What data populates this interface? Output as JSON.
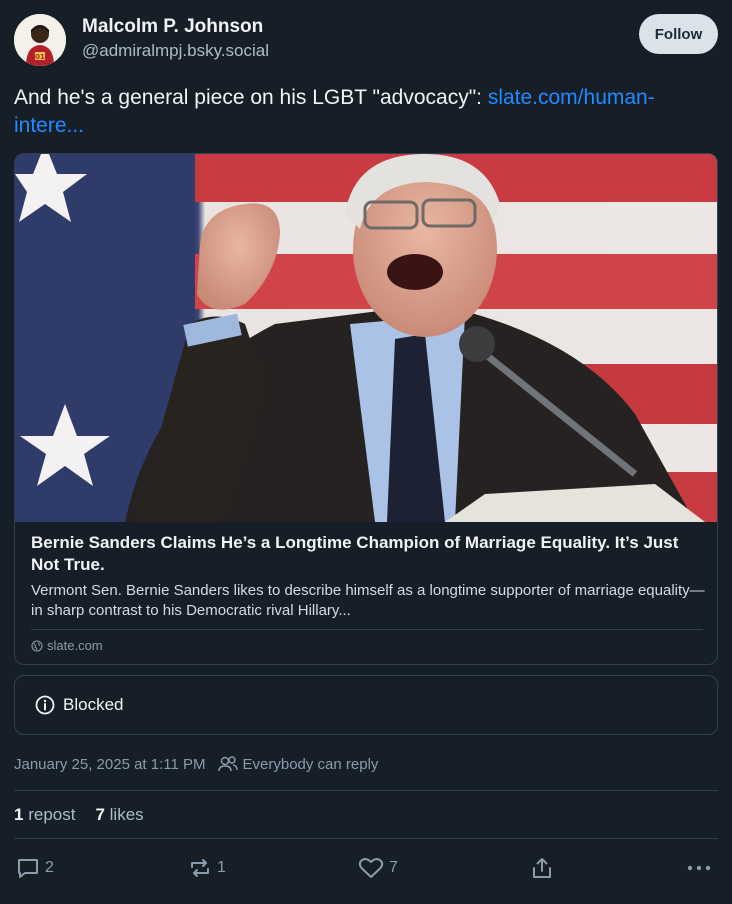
{
  "author": {
    "display_name": "Malcolm P. Johnson",
    "handle": "@admiralmpj.bsky.social",
    "avatar_icon": "profile-avatar"
  },
  "follow_label": "Follow",
  "post": {
    "text": "And he's a general piece on his LGBT \"advocacy\": ",
    "link_text": "slate.com/human-intere..."
  },
  "card": {
    "image_icon": "photo-bernie-sanders-speaking",
    "title": "Bernie Sanders Claims He’s a Longtime Champion of Marriage Equality. It’s Just Not True.",
    "description": "Vermont Sen. Bernie Sanders likes to describe himself as a longtime supporter of marriage equality—in sharp contrast to his Democratic rival Hillary...",
    "domain": "slate.com"
  },
  "blocked_label": "Blocked",
  "meta": {
    "timestamp": "January 25, 2025 at 1:11 PM",
    "reply_setting": "Everybody can reply"
  },
  "stats": {
    "reposts_count": "1",
    "reposts_label": "repost",
    "likes_count": "7",
    "likes_label": "likes"
  },
  "actions": {
    "reply_count": "2",
    "repost_count": "1",
    "like_count": "7"
  },
  "colors": {
    "background": "#161e27",
    "link": "#208bfe",
    "border": "#2e4052",
    "muted": "#8c9bab"
  }
}
